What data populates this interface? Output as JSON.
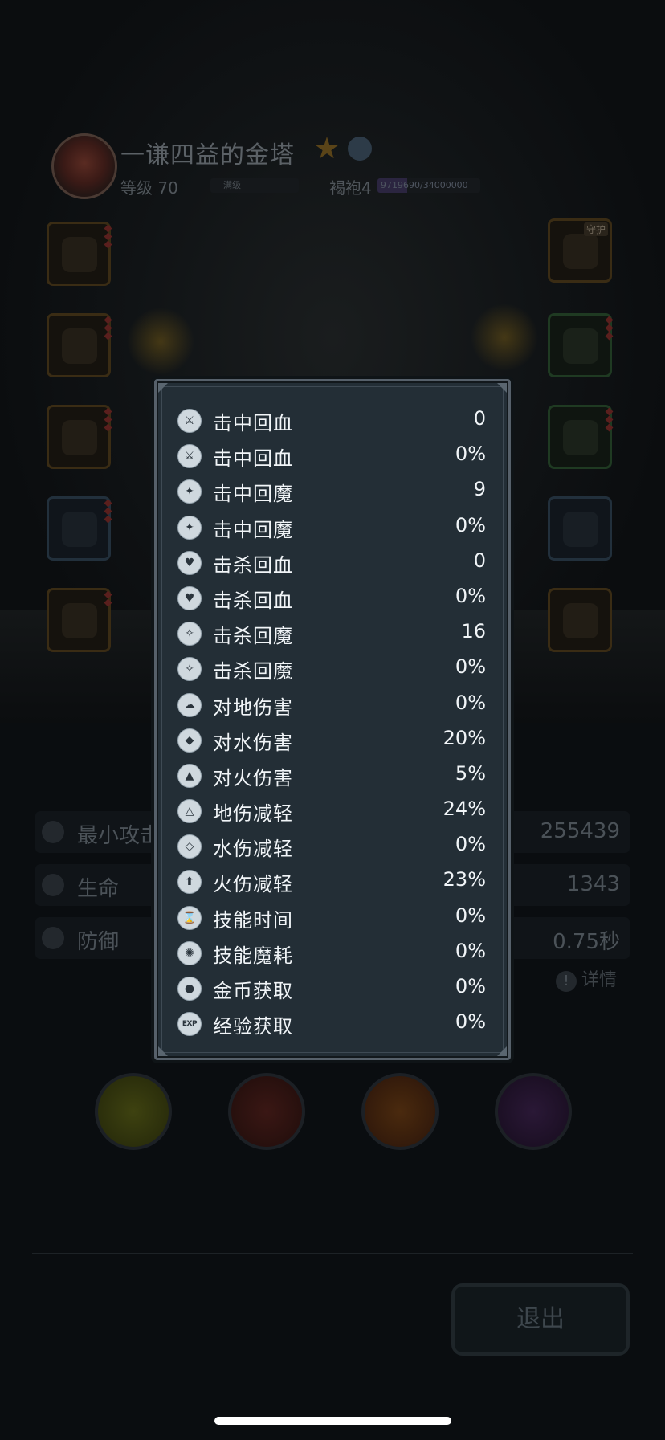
{
  "hero": {
    "name": "一谦四益的金塔",
    "level_label": "等级 70",
    "level_bar_text": "满级",
    "rank_label": "褐袍4",
    "exp_text": "9719690/34000000",
    "exp_progress": 0.286
  },
  "equipment": {
    "guard_tag": "守护"
  },
  "stats": [
    {
      "label": "最小攻击",
      "value": "255439",
      "icon": "sword-icon"
    },
    {
      "label": "生命",
      "value": "1343",
      "icon": "heart-icon"
    },
    {
      "label": "防御",
      "value": "0.75秒",
      "icon": "shield-icon"
    }
  ],
  "detail_link": {
    "icon": "!",
    "label": "详情"
  },
  "exit_button": {
    "label": "退出"
  },
  "popup": {
    "attributes": [
      {
        "icon_glyph": "⚔",
        "name": "击中回血",
        "value": "0"
      },
      {
        "icon_glyph": "⚔",
        "name": "击中回血",
        "value": "0%"
      },
      {
        "icon_glyph": "✦",
        "name": "击中回魔",
        "value": "9"
      },
      {
        "icon_glyph": "✦",
        "name": "击中回魔",
        "value": "0%"
      },
      {
        "icon_glyph": "♥",
        "name": "击杀回血",
        "value": "0"
      },
      {
        "icon_glyph": "♥",
        "name": "击杀回血",
        "value": "0%"
      },
      {
        "icon_glyph": "✧",
        "name": "击杀回魔",
        "value": "16"
      },
      {
        "icon_glyph": "✧",
        "name": "击杀回魔",
        "value": "0%"
      },
      {
        "icon_glyph": "☁",
        "name": "对地伤害",
        "value": "0%"
      },
      {
        "icon_glyph": "◆",
        "name": "对水伤害",
        "value": "20%"
      },
      {
        "icon_glyph": "▲",
        "name": "对火伤害",
        "value": "5%"
      },
      {
        "icon_glyph": "△",
        "name": "地伤减轻",
        "value": "24%"
      },
      {
        "icon_glyph": "◇",
        "name": "水伤减轻",
        "value": "0%"
      },
      {
        "icon_glyph": "⬆",
        "name": "火伤减轻",
        "value": "23%"
      },
      {
        "icon_glyph": "⌛",
        "name": "技能时间",
        "value": "0%"
      },
      {
        "icon_glyph": "✺",
        "name": "技能魔耗",
        "value": "0%"
      },
      {
        "icon_glyph": "●",
        "name": "金币获取",
        "value": "0%"
      },
      {
        "icon_glyph": "EXP",
        "name": "经验获取",
        "value": "0%"
      }
    ]
  },
  "colors": {
    "panel_bg": "#232e36",
    "panel_border": "#56606a",
    "text": "#f1f5f8",
    "overlay": "#07090c"
  }
}
